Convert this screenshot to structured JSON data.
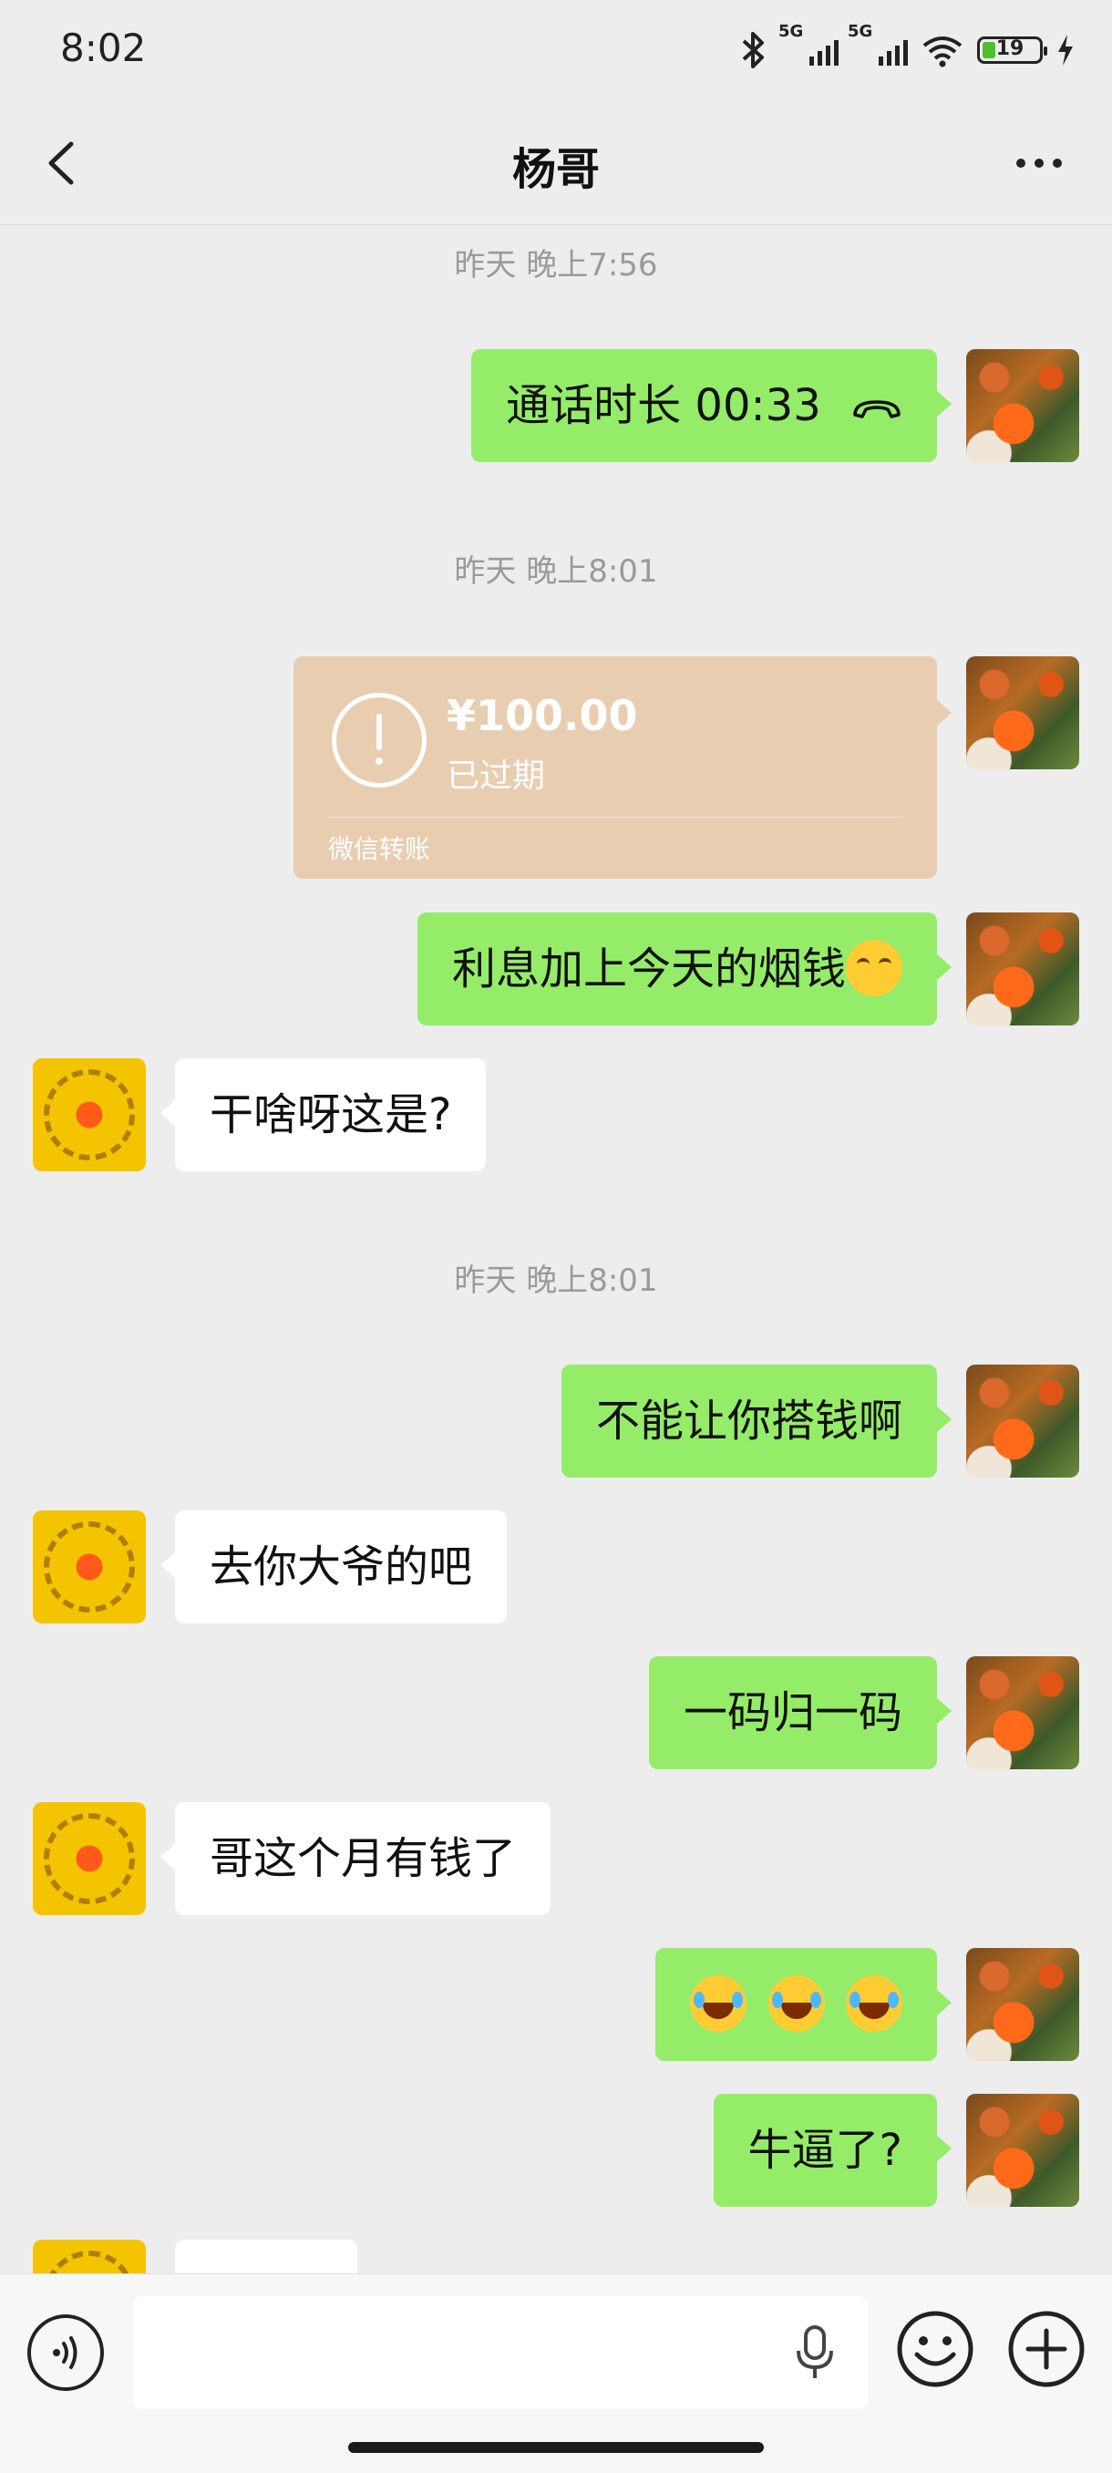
{
  "status_bar": {
    "time": "8:02",
    "network_1": "5G",
    "network_2": "5G",
    "battery": "19",
    "icons": [
      "bluetooth-icon",
      "signal-icon",
      "signal-icon",
      "wifi-icon",
      "battery-icon",
      "charging-icon"
    ]
  },
  "header": {
    "title": "杨哥",
    "back_icon": "chevron-left-icon",
    "more_icon": "more-horizontal-icon"
  },
  "timestamps": [
    "昨天 晚上7:56",
    "昨天 晚上8:01",
    "昨天 晚上8:01"
  ],
  "messages": [
    {
      "from": "me",
      "text": "通话时长 00:33",
      "icon": "call-end-icon"
    },
    {
      "from": "me",
      "type": "transfer",
      "amount": "¥100.00",
      "status": "已过期",
      "label": "微信转账"
    },
    {
      "from": "me",
      "text": "利息加上今天的烟钱",
      "emoji": "smirk-emoji"
    },
    {
      "from": "other",
      "text": "干啥呀这是?"
    },
    {
      "from": "me",
      "text": "不能让你搭钱啊"
    },
    {
      "from": "other",
      "text": "去你大爷的吧"
    },
    {
      "from": "me",
      "text": "一码归一码"
    },
    {
      "from": "other",
      "text": "哥这个月有钱了"
    },
    {
      "from": "me",
      "emojis": [
        "laughing-crying-emoji",
        "laughing-crying-emoji",
        "laughing-crying-emoji"
      ]
    },
    {
      "from": "me",
      "text": "牛逼了?"
    }
  ],
  "input_bar": {
    "placeholder": "",
    "icons": [
      "voice-icon",
      "microphone-icon",
      "emoji-icon",
      "plus-icon"
    ]
  },
  "colors": {
    "background": "#ededed",
    "my_bubble": "#95ec69",
    "other_bubble": "#ffffff",
    "transfer_card": "#e8cdb1"
  }
}
